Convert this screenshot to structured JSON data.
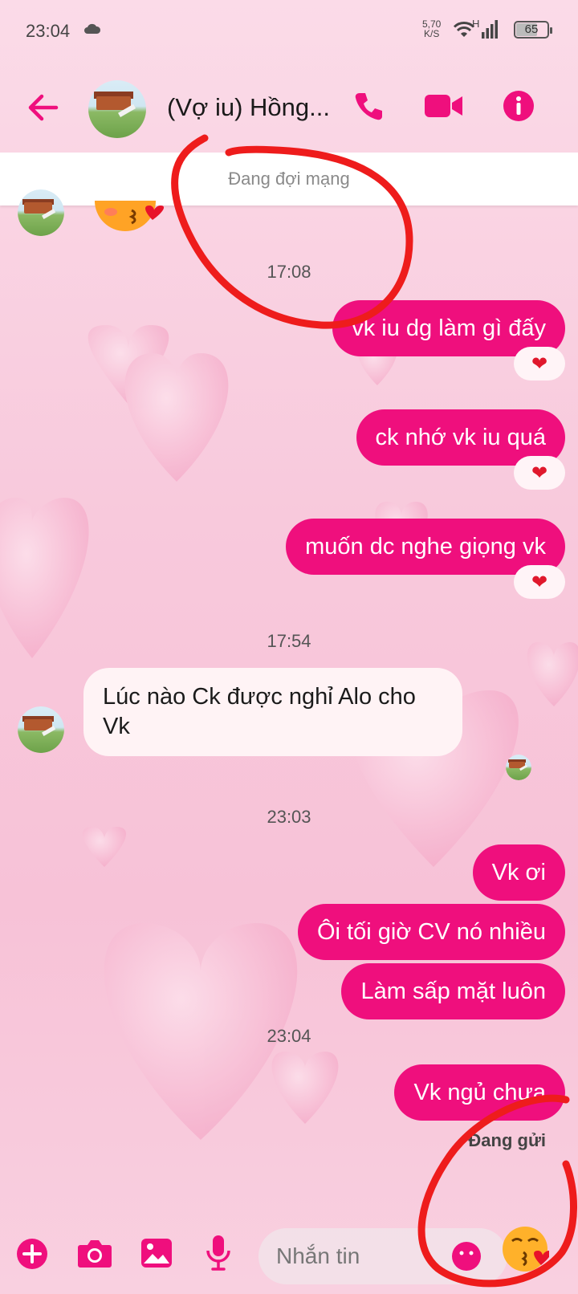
{
  "status_bar": {
    "time": "23:04",
    "net_speed_value": "5,70",
    "net_speed_unit": "K/S",
    "network_type": "H",
    "battery_level": "65"
  },
  "header": {
    "contact_name": "(Vợ iu) Hồng..."
  },
  "banner": {
    "text": "Đang đợi mạng"
  },
  "messages": {
    "time_1": "17:08",
    "out_1": "vk iu dg làm gì đấy",
    "out_2": "ck nhớ vk iu quá",
    "out_3": "muốn dc nghe giọng vk",
    "time_2": "17:54",
    "in_1": "Lúc nào Ck được nghỉ Alo cho Vk",
    "time_3": "23:03",
    "out_4": "Vk ơi",
    "out_5": "Ôi tối giờ CV nó nhiều",
    "out_6": "Làm sấp mặt luôn",
    "time_4": "23:04",
    "out_7": "Vk ngủ chưa",
    "status": "Đang gửi",
    "reaction": "❤"
  },
  "composer": {
    "placeholder": "Nhắn tin"
  },
  "colors": {
    "accent": "#ef0f7d",
    "annotation": "#ee1c1c"
  }
}
